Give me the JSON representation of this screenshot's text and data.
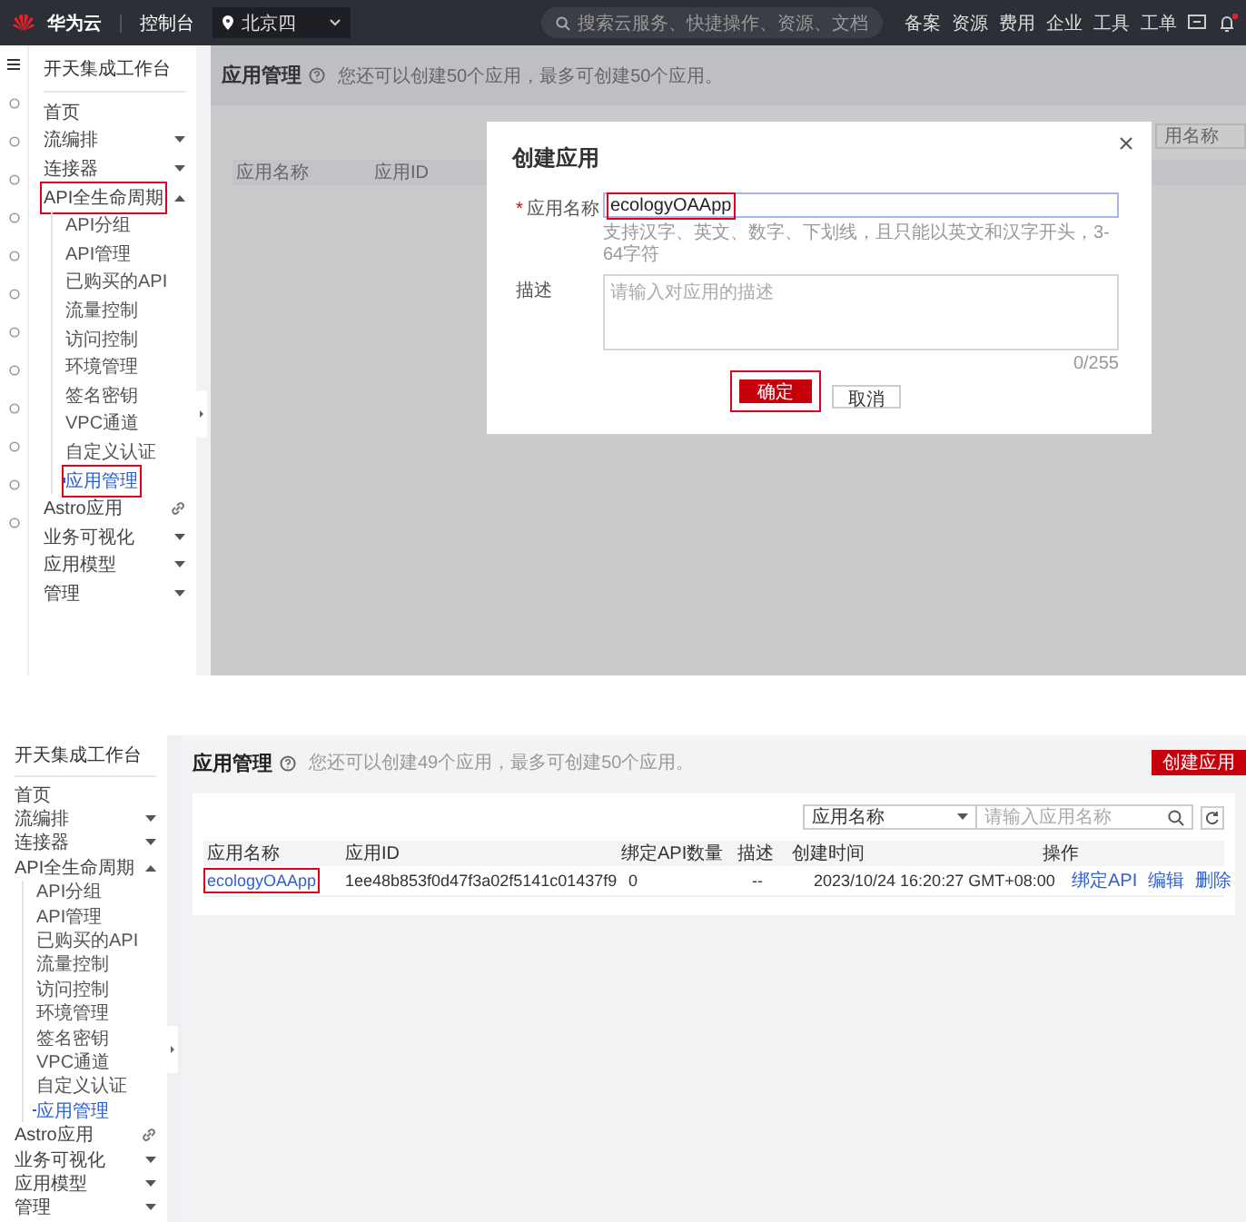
{
  "shots": [
    {
      "top_bar": {
        "brand": "华为云",
        "console": "控制台",
        "region": "北京四",
        "search_placeholder": "搜索云服务、快捷操作、资源、文档",
        "links": [
          "备案",
          "资源",
          "费用",
          "企业",
          "工具",
          "工单"
        ]
      },
      "sidebar": {
        "title": "开天集成工作台",
        "items": [
          {
            "kind": "plain",
            "label": "首页",
            "highlighted": false
          },
          {
            "kind": "group",
            "label": "流编排",
            "expanded": false,
            "highlighted": false
          },
          {
            "kind": "group",
            "label": "连接器",
            "expanded": false,
            "highlighted": false
          },
          {
            "kind": "group",
            "label": "API全生命周期",
            "expanded": true,
            "highlighted": true,
            "children": [
              {
                "label": "API分组",
                "selected": false,
                "highlighted": false
              },
              {
                "label": "API管理",
                "selected": false,
                "highlighted": false
              },
              {
                "label": "已购买的API",
                "selected": false,
                "highlighted": false
              },
              {
                "label": "流量控制",
                "selected": false,
                "highlighted": false
              },
              {
                "label": "访问控制",
                "selected": false,
                "highlighted": false
              },
              {
                "label": "环境管理",
                "selected": false,
                "highlighted": false
              },
              {
                "label": "签名密钥",
                "selected": false,
                "highlighted": false
              },
              {
                "label": "VPC通道",
                "selected": false,
                "highlighted": false
              },
              {
                "label": "自定义认证",
                "selected": false,
                "highlighted": false
              },
              {
                "label": "应用管理",
                "selected": true,
                "highlighted": true
              }
            ]
          },
          {
            "kind": "link",
            "label": "Astro应用",
            "highlighted": false
          },
          {
            "kind": "group",
            "label": "业务可视化",
            "expanded": false,
            "highlighted": false
          },
          {
            "kind": "group",
            "label": "应用模型",
            "expanded": false,
            "highlighted": false
          },
          {
            "kind": "group",
            "label": "管理",
            "expanded": false,
            "highlighted": false
          }
        ]
      },
      "page": {
        "title": "应用管理",
        "hint": "您还可以创建50个应用，最多可创建50个应用。",
        "filter_select": "用名称",
        "columns": [
          "应用名称",
          "应用ID"
        ]
      },
      "dialog": {
        "title": "创建应用",
        "required_mark": "*",
        "name_label": "应用名称",
        "name_value": "ecologyOAApp",
        "name_highlighted": true,
        "name_hint": "支持汉字、英文、数字、下划线，且只能以英文和汉字开头，3-64字符",
        "desc_label": "描述",
        "desc_placeholder": "请输入对应用的描述",
        "counter": "0/255",
        "confirm": "确定",
        "confirm_highlighted": true,
        "cancel": "取消"
      }
    },
    {
      "sidebar": {
        "title": "开天集成工作台",
        "items": [
          {
            "kind": "plain",
            "label": "首页",
            "highlighted": false
          },
          {
            "kind": "group",
            "label": "流编排",
            "expanded": false,
            "highlighted": false
          },
          {
            "kind": "group",
            "label": "连接器",
            "expanded": false,
            "highlighted": false
          },
          {
            "kind": "group",
            "label": "API全生命周期",
            "expanded": true,
            "highlighted": false,
            "children": [
              {
                "label": "API分组",
                "selected": false,
                "highlighted": false
              },
              {
                "label": "API管理",
                "selected": false,
                "highlighted": false
              },
              {
                "label": "已购买的API",
                "selected": false,
                "highlighted": false
              },
              {
                "label": "流量控制",
                "selected": false,
                "highlighted": false
              },
              {
                "label": "访问控制",
                "selected": false,
                "highlighted": false
              },
              {
                "label": "环境管理",
                "selected": false,
                "highlighted": false
              },
              {
                "label": "签名密钥",
                "selected": false,
                "highlighted": false
              },
              {
                "label": "VPC通道",
                "selected": false,
                "highlighted": false
              },
              {
                "label": "自定义认证",
                "selected": false,
                "highlighted": false
              },
              {
                "label": "应用管理",
                "selected": true,
                "highlighted": false
              }
            ]
          },
          {
            "kind": "link",
            "label": "Astro应用",
            "highlighted": false
          },
          {
            "kind": "group",
            "label": "业务可视化",
            "expanded": false,
            "highlighted": false
          },
          {
            "kind": "group",
            "label": "应用模型",
            "expanded": false,
            "highlighted": false
          },
          {
            "kind": "group",
            "label": "管理",
            "expanded": false,
            "highlighted": false
          }
        ]
      },
      "page": {
        "title": "应用管理",
        "hint": "您还可以创建49个应用，最多可创建50个应用。",
        "create_button": "创建应用",
        "filter_select": "应用名称",
        "search_placeholder": "请输入应用名称",
        "columns": [
          "应用名称",
          "应用ID",
          "绑定API数量",
          "描述",
          "创建时间",
          "操作"
        ],
        "rows": [
          {
            "cells": [
              "ecologyOAApp",
              "1ee48b853f0d47f3a02f5141c01437f9",
              "0",
              "--",
              "2023/10/24 16:20:27 GMT+08:00"
            ],
            "name_highlighted": true,
            "actions": [
              "绑定API",
              "编辑",
              "删除"
            ]
          }
        ]
      }
    }
  ]
}
